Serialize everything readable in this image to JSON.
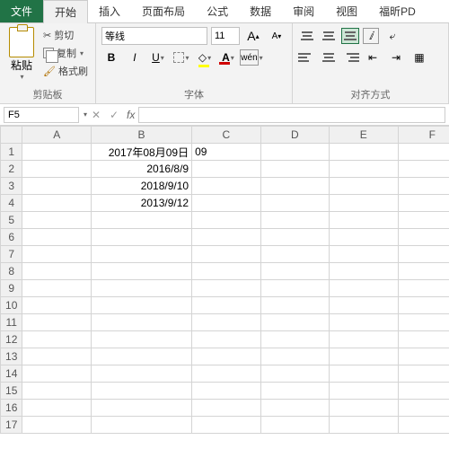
{
  "tabs": {
    "file": "文件",
    "home": "开始",
    "insert": "插入",
    "layout": "页面布局",
    "formula": "公式",
    "data": "数据",
    "review": "审阅",
    "view": "视图",
    "foxit": "福昕PD"
  },
  "clipboard": {
    "paste": "粘贴",
    "cut": "剪切",
    "copy": "复制",
    "painter": "格式刷",
    "group": "剪贴板"
  },
  "font": {
    "family": "等线",
    "size": "11",
    "bold": "B",
    "italic": "I",
    "underline": "U",
    "wen": "wén",
    "A": "A",
    "group": "字体"
  },
  "align": {
    "group": "对齐方式"
  },
  "namebox": "F5",
  "cells": {
    "B1": "2017年08月09日",
    "C1": "09",
    "B2": "2016/8/9",
    "B3": "2018/9/10",
    "B4": "2013/9/12"
  },
  "cols": [
    "A",
    "B",
    "C",
    "D",
    "E",
    "F"
  ],
  "rows": 17
}
